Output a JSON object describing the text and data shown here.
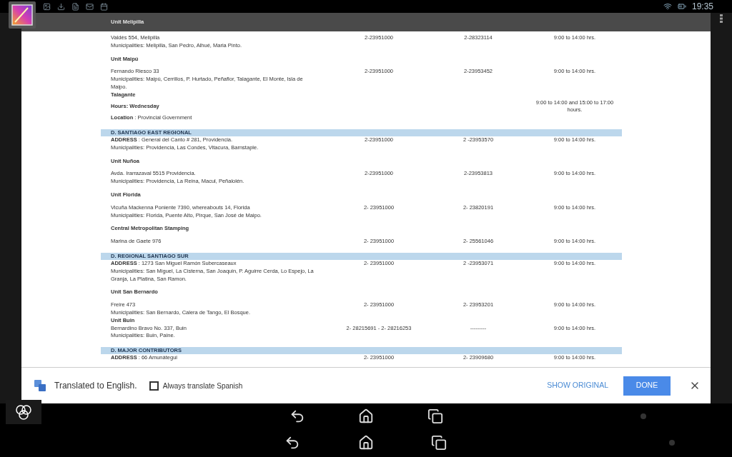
{
  "status_bar": {
    "time": "19:35"
  },
  "header_row": {
    "text": "Unit Melipilla"
  },
  "rows": [
    {
      "kind": "line",
      "text": "Valdés 554, Melipilla",
      "column_2": "2-23951000",
      "column_3": "2-28323114",
      "column_4": "9:00 to 14:00 hrs."
    },
    {
      "kind": "line",
      "text": "Municipalities: Melipilla, San Pedro, Alhué, Maria Pinto."
    },
    {
      "kind": "heading",
      "text": "Unit Maipú"
    },
    {
      "kind": "line",
      "text": "Fernando Riesco 33",
      "column_2": "2-23951000",
      "column_3": "2-23953452",
      "column_4": "9:00 to 14:00 hrs."
    },
    {
      "kind": "line",
      "text": "Municipalities: Maipú, Cerrillos, P. Hurtado, Peñaflor, Talagante, El Monte, Isla de Maipo."
    },
    {
      "kind": "label",
      "text": "Talagante"
    },
    {
      "kind": "label",
      "text": "Hours: Wednesday",
      "column_4": "9:00 to 14:00 and 15:00 to 17:00 hours."
    },
    {
      "kind": "line",
      "text": "**Location** : Provincial Government"
    },
    {
      "kind": "banner",
      "text": "D. SANTIAGO EAST REGIONAL"
    },
    {
      "kind": "line",
      "text": "**ADDRESS** : General del Canto # 281, Providencia.",
      "column_2": "2-23951000",
      "column_3": "2 -23953570",
      "column_4": "9:00 to 14:00 hrs."
    },
    {
      "kind": "line",
      "text": "Municipalities: Providencia, Las Condes, Vitacura, Barnstaple."
    },
    {
      "kind": "heading",
      "text": "Unit Nuñoa"
    },
    {
      "kind": "line",
      "text": "Avda. Irarrazaval 5515 Providencia.",
      "column_2": "2-23951000",
      "column_3": "2-23953813",
      "column_4": "9:00 to 14:00 hrs."
    },
    {
      "kind": "line",
      "text": "Municipalities: Providencia, La Reina, Macul, Peñalolén."
    },
    {
      "kind": "heading",
      "text": "Unit Florida"
    },
    {
      "kind": "line",
      "text": "Vicuña Mackenna Poniente 7390, whereabouts 14, Florida",
      "column_2": "2- 23951000",
      "column_3": "2- 23820191",
      "column_4": "9:00 to 14:00 hrs."
    },
    {
      "kind": "line",
      "text": "Municipalities: Florida, Puente Alto, Pirque, San José de Maipo."
    },
    {
      "kind": "heading",
      "text": "Central Metropolitan Stamping"
    },
    {
      "kind": "line",
      "text": "Marina de Gaete 976",
      "column_2": "2- 23951000",
      "column_3": "2- 25561046",
      "column_4": "9:00 to 14:00 hrs."
    },
    {
      "kind": "banner",
      "text": "D. REGIONAL SANTIAGO SUR"
    },
    {
      "kind": "line",
      "text": "**ADDRESS** : 1273 San Miguel Ramón Subercaseaux",
      "column_2": "2- 23951000",
      "column_3": "2 -23953071",
      "column_4": "9:00 to 14:00 hrs."
    },
    {
      "kind": "line",
      "text": "Municipalities: San Miguel, La Cisterna, San Joaquin, P. Aguirre Cerda, Lo Espejo, La Granja, La Platina, San Ramon."
    },
    {
      "kind": "heading",
      "text": "Unit San Bernardo"
    },
    {
      "kind": "line",
      "text": "Freire 473",
      "column_2": "2- 23951000",
      "column_3": "2- 23953201",
      "column_4": "9:00 to 14:00 hrs."
    },
    {
      "kind": "line",
      "text": "Municipalities: San Bernardo, Calera de Tango, El Bosque."
    },
    {
      "kind": "label",
      "text": "Unit Buin"
    },
    {
      "kind": "line",
      "text": "Bernardino Bravo No. 337, Buin",
      "column_2": "2- 28215691 - 2- 28216253",
      "column_3": "---------",
      "column_4": "9:00 to 14:00 hrs."
    },
    {
      "kind": "line",
      "text": "Municipalities: Buin, Paine."
    },
    {
      "kind": "banner",
      "text": "D. MAJOR CONTRIBUTORS"
    },
    {
      "kind": "line",
      "text": "**ADDRESS** : 66 Amunátegui",
      "column_2": "2- 23951000",
      "column_3": "2- 23909680",
      "column_4": "9:00 to 14:00 hrs."
    }
  ],
  "translate_bar": {
    "message": "Translated to English.",
    "checkbox": {
      "label": "Always translate Spanish",
      "checked": false
    },
    "link": "SHOW ORIGINAL",
    "button": "DONE"
  }
}
